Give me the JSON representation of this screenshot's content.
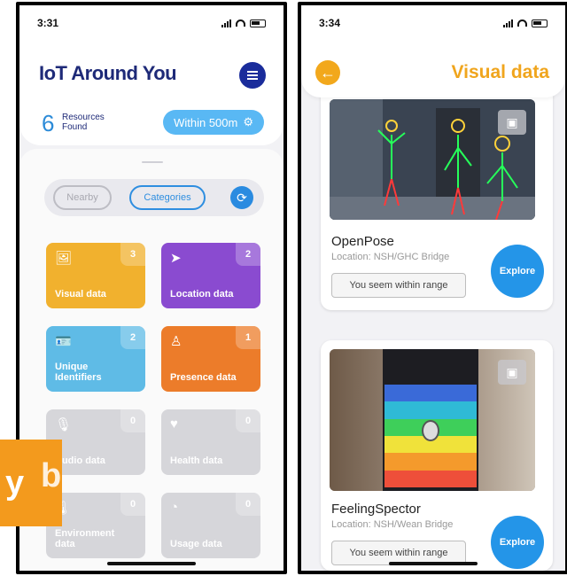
{
  "left": {
    "time": "3:31",
    "app_title": "IoT Around You",
    "resources_count": "6",
    "resources_label_1": "Resources",
    "resources_label_2": "Found",
    "range_label": "Within 500m",
    "tabs": [
      "Nearby",
      "Categories"
    ],
    "selected_tab": "Categories",
    "categories": [
      {
        "label": "Visual data",
        "count": "3",
        "icon": "image-icon",
        "color": "#f1b12e"
      },
      {
        "label": "Location data",
        "count": "2",
        "icon": "location-arrow-icon",
        "color": "#8a4bd0"
      },
      {
        "label": "Unique Identifiers",
        "count": "2",
        "icon": "id-card-icon",
        "color": "#5fbbe6"
      },
      {
        "label": "Presence data",
        "count": "1",
        "icon": "person-presence-icon",
        "color": "#ec7c2a"
      },
      {
        "label": "Audio data",
        "count": "0",
        "icon": "microphone-icon",
        "color": "#d6d6da"
      },
      {
        "label": "Health data",
        "count": "0",
        "icon": "heart-pulse-icon",
        "color": "#d6d6da"
      },
      {
        "label": "Environment data",
        "count": "0",
        "icon": "thermometer-icon",
        "color": "#d6d6da"
      },
      {
        "label": "Usage data",
        "count": "0",
        "icon": "pie-chart-icon",
        "color": "#d6d6da"
      }
    ]
  },
  "overlay": {
    "text": "y",
    "ghost": "b"
  },
  "right": {
    "time": "3:34",
    "page_title": "Visual data",
    "cards": [
      {
        "name": "OpenPose",
        "location": "Location: NSH/GHC Bridge",
        "range": "You seem within range",
        "action": "Explore"
      },
      {
        "name": "FeelingSpector",
        "location": "Location: NSH/Wean Bridge",
        "range": "You seem within range",
        "action": "Explore"
      }
    ]
  }
}
